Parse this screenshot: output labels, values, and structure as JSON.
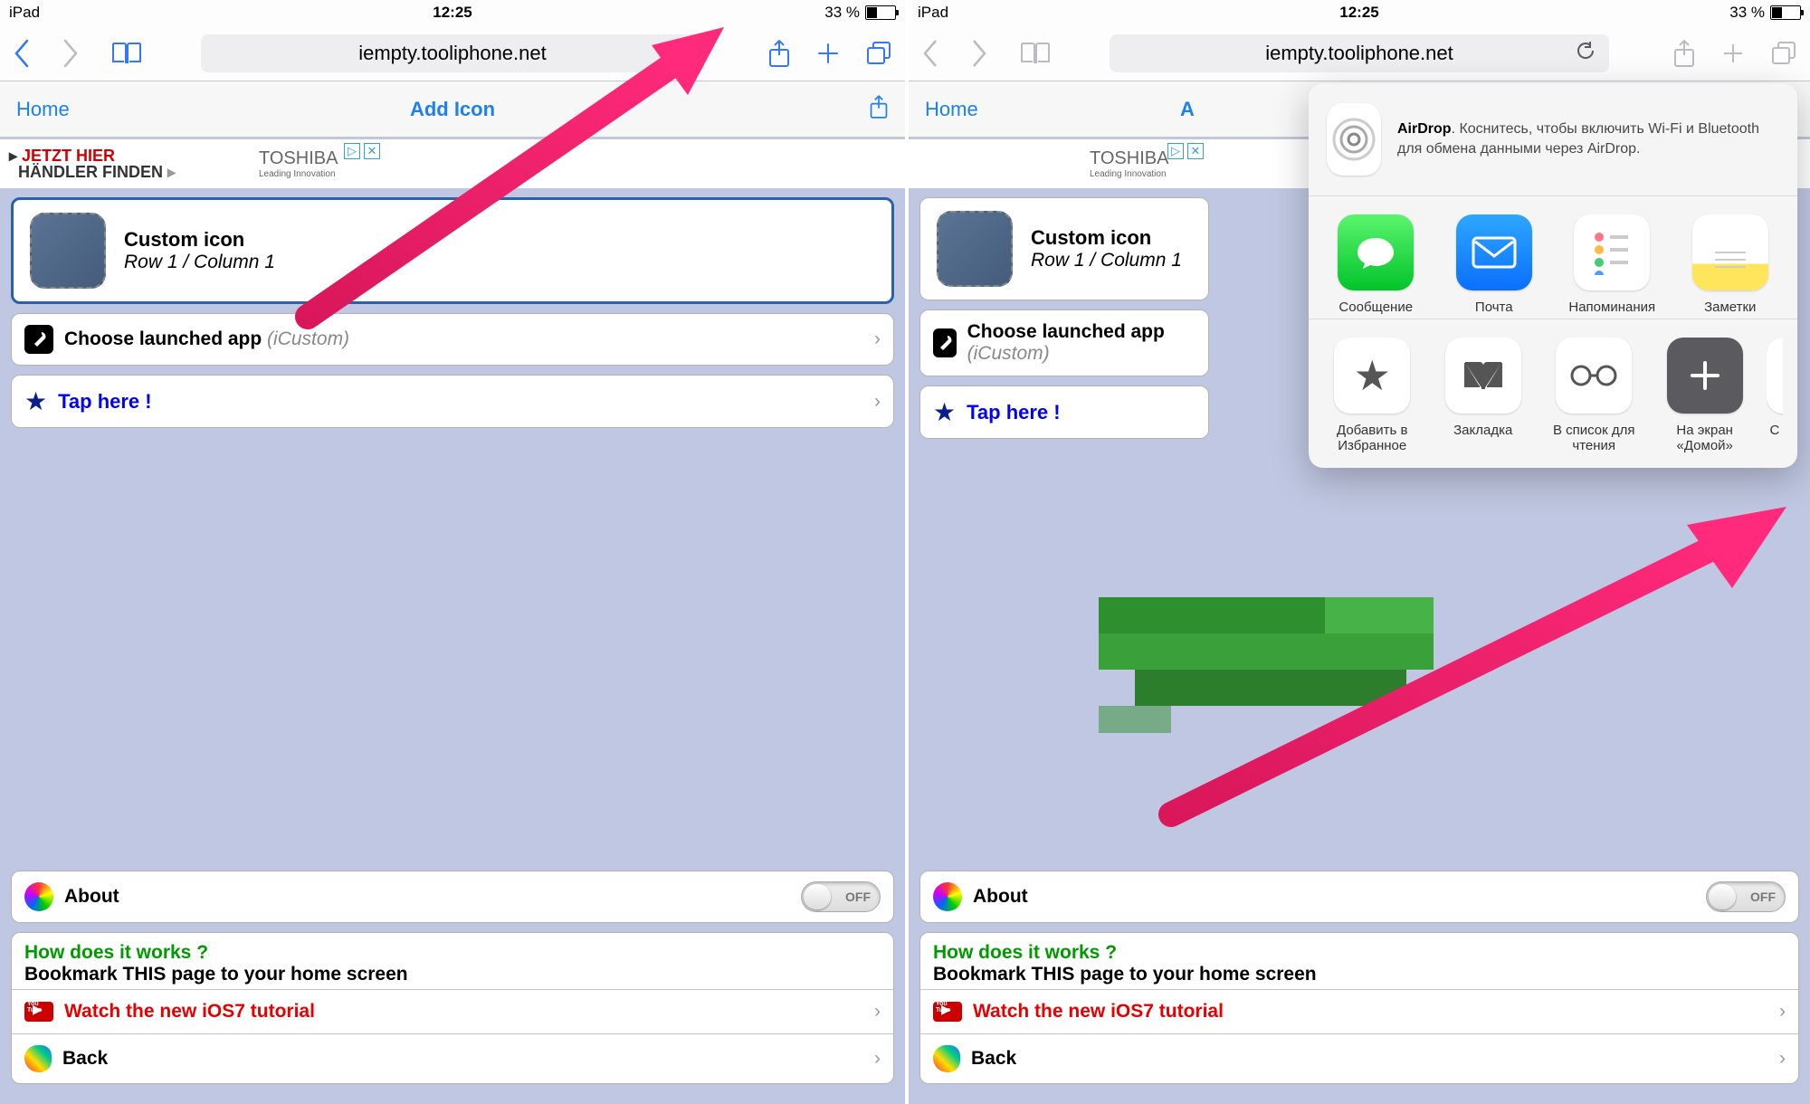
{
  "status": {
    "device": "iPad",
    "time": "12:25",
    "battery_pct": "33 %"
  },
  "safari": {
    "url": "iempty.tooliphone.net"
  },
  "page": {
    "home": "Home",
    "title": "Add Icon",
    "ad_line1": "JETZT HIER",
    "ad_line2": "HÄNDLER FINDEN",
    "ad_brand": "TOSHIBA",
    "ad_tag": "Leading Innovation",
    "custom_icon_title": "Custom icon",
    "custom_icon_sub": "Row 1 / Column 1",
    "choose_label": "Choose launched app",
    "choose_hint": "(iCustom)",
    "taphere": "Tap here !",
    "about": "About",
    "toggle_off": "OFF",
    "help_q": "How does it works ?",
    "help_instr": "Bookmark THIS page to your home screen",
    "watch": "Watch the new iOS7 tutorial",
    "back": "Back",
    "truncated_title": "A"
  },
  "share": {
    "airdrop_title": "AirDrop",
    "airdrop_msg": ". Коснитесь, чтобы включить Wi-Fi и Bluetooth для обмена данными через AirDrop.",
    "row1": [
      {
        "name": "messages",
        "label": "Сообщение"
      },
      {
        "name": "mail",
        "label": "Почта"
      },
      {
        "name": "reminders",
        "label": "Напоминания"
      },
      {
        "name": "notes",
        "label": "Заметки"
      }
    ],
    "row2": [
      {
        "name": "favorite",
        "label": "Добавить в Избранное"
      },
      {
        "name": "bookmark",
        "label": "Закладка"
      },
      {
        "name": "readinglist",
        "label": "В список для чтения"
      },
      {
        "name": "homescreen",
        "label": "На экран «Домой»"
      }
    ],
    "more_char": "С"
  }
}
